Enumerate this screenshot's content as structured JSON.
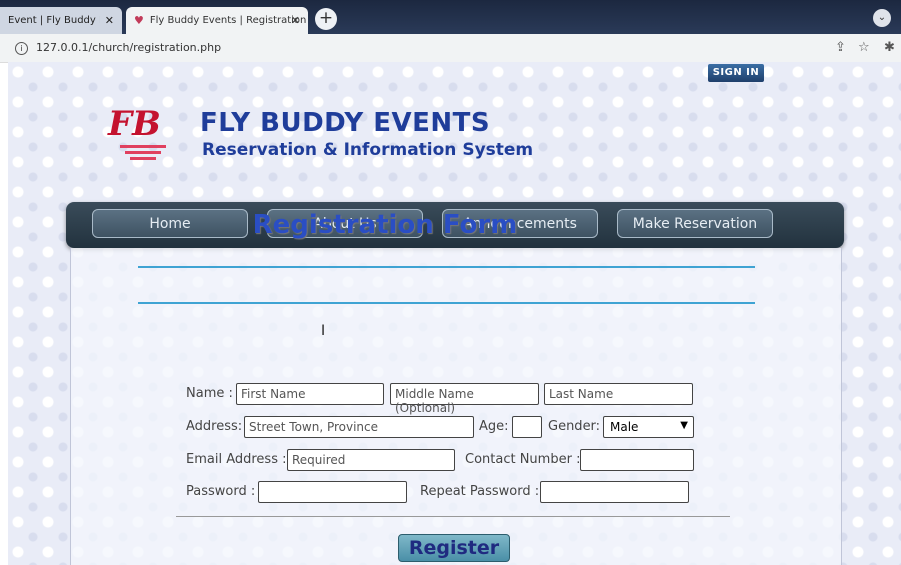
{
  "browser": {
    "tabs": [
      {
        "title": "Event | Fly Buddy Event",
        "active": false
      },
      {
        "title": "Fly Buddy Events | Registration",
        "active": true
      }
    ],
    "new_tab": "+",
    "url": "127.0.0.1/church/registration.php"
  },
  "header": {
    "signin": "SIGN IN",
    "logo_text": "FB",
    "title": "FLY BUDDY EVENTS",
    "subtitle": "Reservation & Information System"
  },
  "nav": {
    "items": [
      "Home",
      "About Us",
      "Announcements",
      "Make Reservation"
    ]
  },
  "form": {
    "title": "Registration Form",
    "name_label": "Name :",
    "first_name_placeholder": "First Name",
    "middle_name_placeholder": "Middle Name (Optional)",
    "last_name_placeholder": "Last Name",
    "address_label": "Address:",
    "address_placeholder": "Street Town, Province",
    "age_label": "Age:",
    "gender_label": "Gender:",
    "gender_value": "Male",
    "email_label": "Email Address :",
    "email_placeholder": "Required",
    "contact_label": "Contact Number :",
    "password_label": "Password :",
    "repeat_password_label": "Repeat Password :",
    "register_label": "Register"
  },
  "colors": {
    "brand_blue": "#1f3d9a",
    "form_title": "#2a4ec4",
    "divider": "#3fa3d3",
    "logo_red": "#c4122f"
  }
}
